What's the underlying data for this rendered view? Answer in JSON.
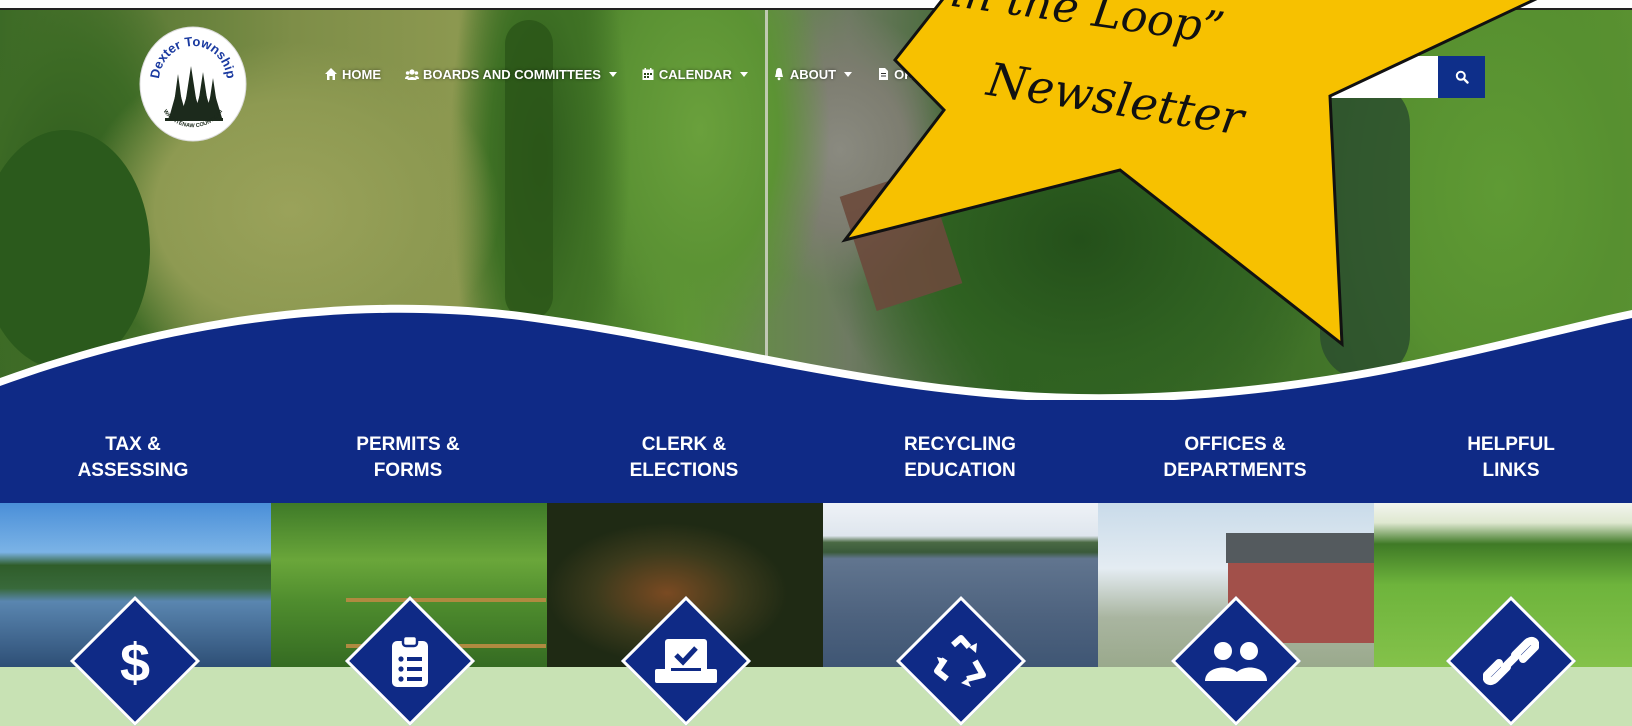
{
  "nav": {
    "items": [
      {
        "label": "HOME",
        "icon": "home-icon",
        "has_dropdown": false
      },
      {
        "label": "BOARDS AND COMMITTEES",
        "icon": "users-icon",
        "has_dropdown": true
      },
      {
        "label": "CALENDAR",
        "icon": "calendar-icon",
        "has_dropdown": true
      },
      {
        "label": "ABOUT",
        "icon": "bell-icon",
        "has_dropdown": true
      },
      {
        "label": "ORDI",
        "icon": "file-icon",
        "has_dropdown": false
      }
    ]
  },
  "logo": {
    "name": "Dexter Township",
    "subtitle": "WASHTENAW COUNTY, MI"
  },
  "search": {
    "placeholder": "",
    "button_icon": "search-icon"
  },
  "promo": {
    "line1": "in the Loop”",
    "line2": "Newsletter",
    "color": "#f7c100"
  },
  "quick_links": [
    {
      "line1": "TAX &",
      "line2": "ASSESSING",
      "icon": "dollar-icon"
    },
    {
      "line1": "PERMITS &",
      "line2": "FORMS",
      "icon": "clipboard-icon"
    },
    {
      "line1": "CLERK &",
      "line2": "ELECTIONS",
      "icon": "ballot-icon"
    },
    {
      "line1": "RECYCLING",
      "line2": "EDUCATION",
      "icon": "recycle-icon"
    },
    {
      "line1": "OFFICES &",
      "line2": "DEPARTMENTS",
      "icon": "people-icon"
    },
    {
      "line1": "HELPFUL",
      "line2": "LINKS",
      "icon": "link-icon"
    }
  ],
  "colors": {
    "brand_blue": "#0f2a86",
    "promo_yellow": "#f7c100",
    "footer_green": "#c8e2b4"
  }
}
